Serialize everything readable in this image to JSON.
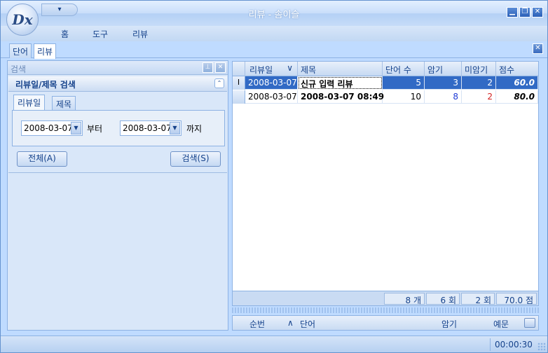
{
  "window": {
    "title": "리뷰 - 솜이슬",
    "logo_text": "Dx",
    "qat_glyph": "▾",
    "controls": [
      "▁",
      "❐",
      "✕"
    ]
  },
  "menu": {
    "items": [
      "홈",
      "도구",
      "리뷰"
    ]
  },
  "doc_tabs": [
    "단어",
    "리뷰"
  ],
  "doc_tabs_active": "리뷰",
  "left_panel": {
    "header": "검색",
    "group_title": "리뷰일/제목 검색",
    "tabs": [
      "리뷰일",
      "제목"
    ],
    "from_date": "2008-03-07",
    "from_label": "부터",
    "to_date": "2008-03-07",
    "to_label": "까지",
    "all_button": "전체(A)",
    "search_button": "검색(S)"
  },
  "grid": {
    "columns": [
      "리뷰일",
      "제목",
      "단어 수",
      "암기",
      "미암기",
      "점수"
    ],
    "sort_glyph": "∨",
    "rows": [
      {
        "indicator": "I",
        "date": "2008-03-07",
        "title": "신규 입력 리뷰",
        "words": "5",
        "memorized": "3",
        "unmemorized": "2",
        "score": "60.0",
        "selected": true
      },
      {
        "indicator": "",
        "date": "2008-03-07",
        "title": "2008-03-07 08:49",
        "words": "10",
        "memorized": "8",
        "unmemorized": "2",
        "score": "80.0",
        "selected": false
      }
    ],
    "footer": [
      "8 개",
      "6 회",
      "2 회",
      "70.0 점"
    ]
  },
  "detail_grid": {
    "columns": [
      "순번",
      "단어",
      "암기",
      "예문"
    ],
    "sort_glyph": "∧"
  },
  "status": {
    "time": "00:00:30"
  },
  "colors": {
    "selected_row": "#316ac5",
    "memorized": "#1f3bd6",
    "unmemorized": "#d21f1f"
  }
}
